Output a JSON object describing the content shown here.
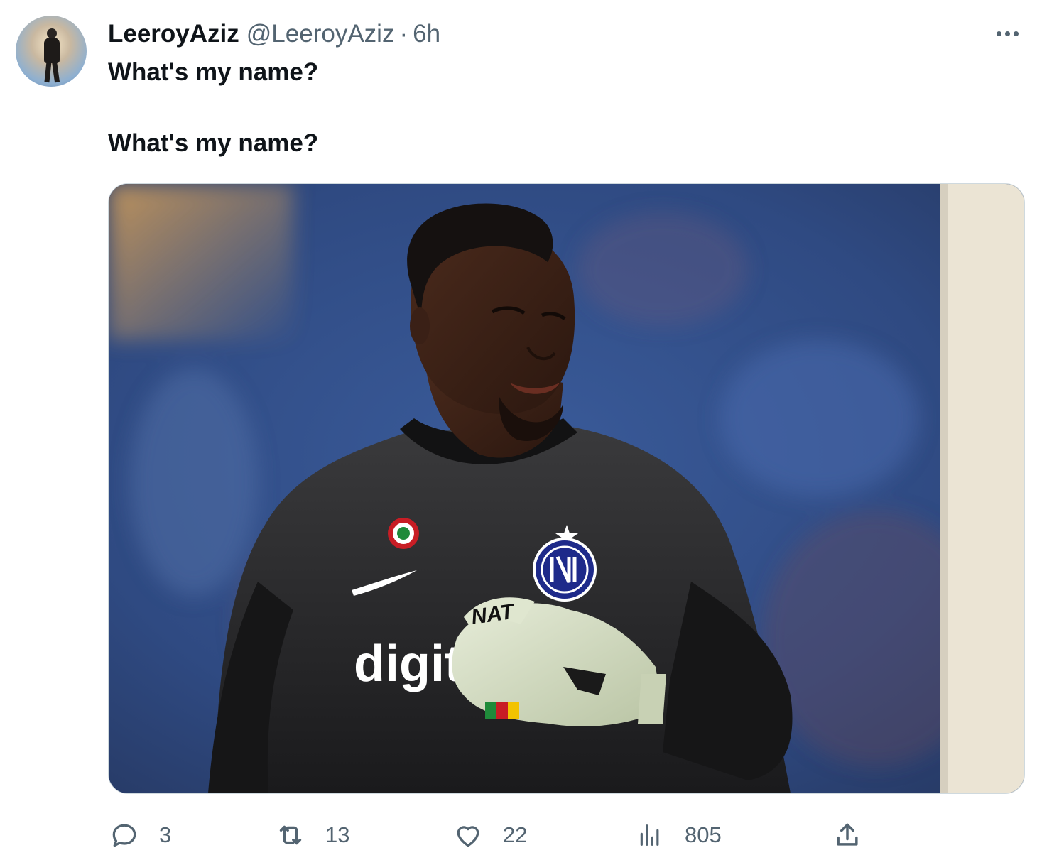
{
  "tweet": {
    "author": {
      "display_name": "LeeroyAziz",
      "handle": "@LeeroyAziz"
    },
    "separator": "·",
    "time": "6h",
    "lines": [
      "What's my name?",
      "What's my name?"
    ],
    "media": {
      "jersey_text": "digit",
      "glove_text": "NAT"
    },
    "actions": {
      "replies": "3",
      "retweets": "13",
      "likes": "22",
      "views": "805"
    },
    "icons": [
      "more-icon",
      "reply-icon",
      "retweet-icon",
      "like-icon",
      "views-icon",
      "share-icon"
    ]
  }
}
